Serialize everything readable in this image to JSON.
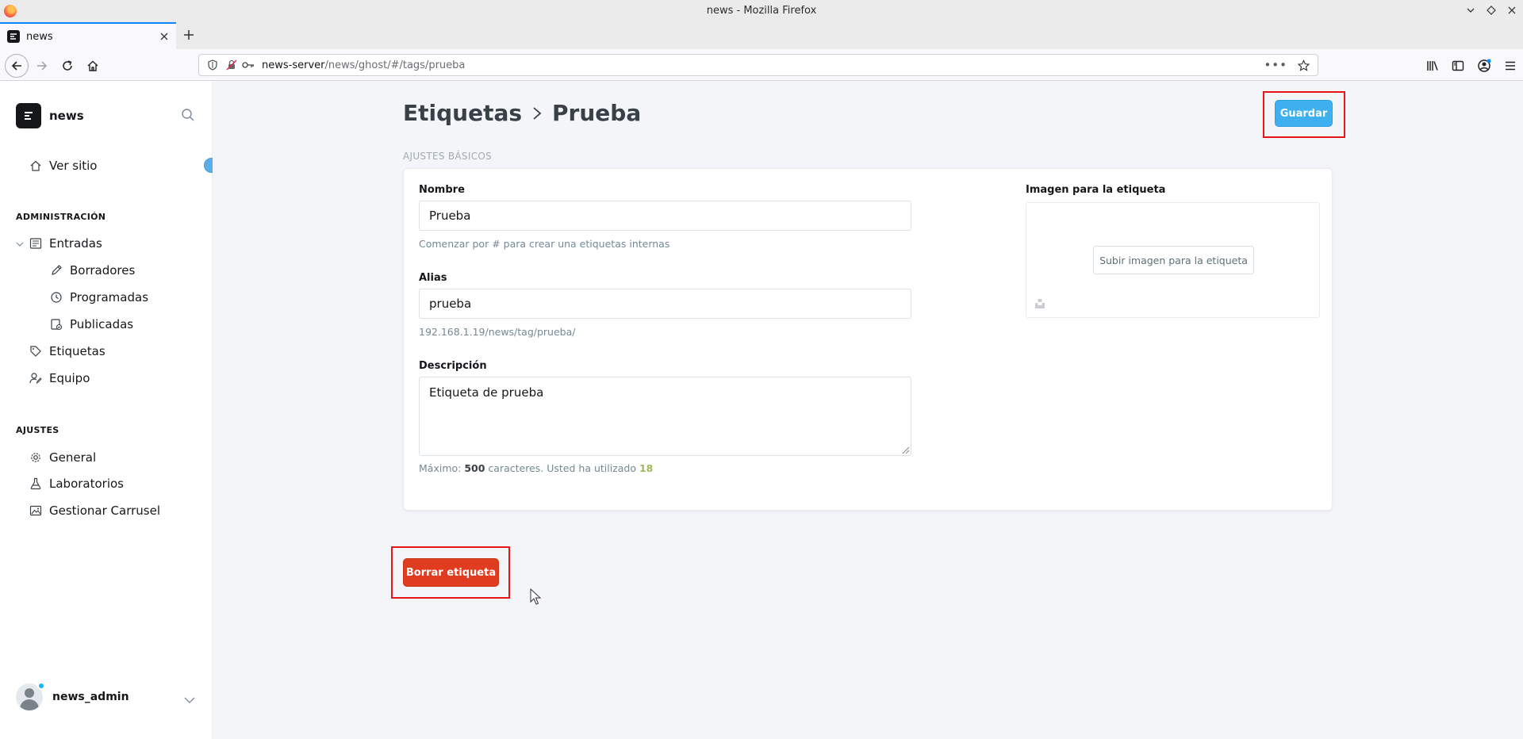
{
  "browser": {
    "window_title": "news - Mozilla Firefox",
    "tab_title": "news",
    "url_host": "news-server",
    "url_path": "/news/ghost/#/tags/prueba"
  },
  "sidebar": {
    "brand": "news",
    "view_site": "Ver sitio",
    "admin_heading": "ADMINISTRACIÓN",
    "posts": "Entradas",
    "drafts": "Borradores",
    "scheduled": "Programadas",
    "published": "Publicadas",
    "tags": "Etiquetas",
    "staff": "Equipo",
    "settings_heading": "AJUSTES",
    "general": "General",
    "labs": "Laboratorios",
    "carousel": "Gestionar Carrusel",
    "user_name": "news_admin"
  },
  "page": {
    "breadcrumb_parent": "Etiquetas",
    "breadcrumb_sep": ">",
    "breadcrumb_current": "Prueba",
    "save_label": "Guardar",
    "section_label": "AJUSTES BÁSICOS",
    "name_label": "Nombre",
    "name_value": "Prueba",
    "name_hint": "Comenzar por # para crear una etiquetas internas",
    "slug_label": "Alias",
    "slug_value": "prueba",
    "slug_url": "192.168.1.19/news/tag/prueba/",
    "desc_label": "Descripción",
    "desc_value": "Etiqueta de prueba",
    "desc_hint_prefix": "Máximo:",
    "desc_hint_max": "500",
    "desc_hint_middle": "caracteres. Usted ha utilizado",
    "desc_hint_count": "18",
    "image_label": "Imagen para la etiqueta",
    "upload_label": "Subir imagen para la etiqueta",
    "delete_label": "Borrar etiqueta"
  },
  "colors": {
    "accent_blue": "#3eb0ef",
    "danger_red": "#e03d20",
    "highlight_red": "#e8161b"
  }
}
